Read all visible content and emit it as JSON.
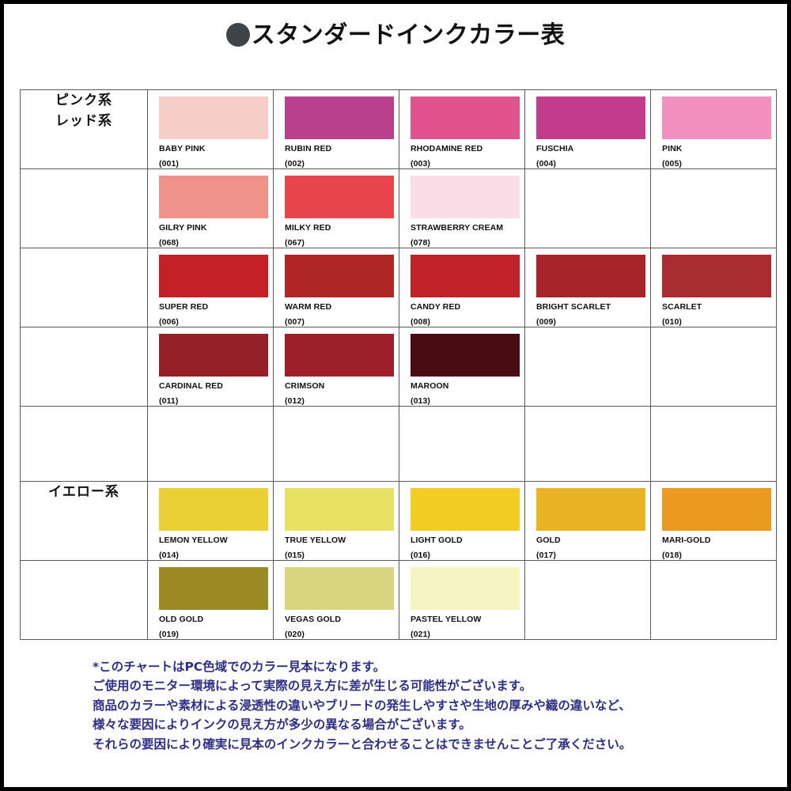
{
  "header": {
    "bullet_icon": "filled-circle-icon",
    "title": "スタンダードインクカラー表",
    "bullet_color": "#3f4449"
  },
  "table": {
    "rows": [
      {
        "category": [
          "ピンク系",
          "レッド系"
        ],
        "swatches": [
          {
            "name": "BABY PINK",
            "code": "(001)",
            "color": "#f7cdc8"
          },
          {
            "name": "RUBIN RED",
            "code": "(002)",
            "color": "#b8408c"
          },
          {
            "name": "RHODAMINE RED",
            "code": "(003)",
            "color": "#e0538f"
          },
          {
            "name": "FUSCHIA",
            "code": "(004)",
            "color": "#c33c8b"
          },
          {
            "name": "PINK",
            "code": "(005)",
            "color": "#f291bf"
          }
        ]
      },
      {
        "category": [],
        "swatches": [
          {
            "name": "GILRY PINK",
            "code": "(068)",
            "color": "#f0918a"
          },
          {
            "name": "MILKY RED",
            "code": "(067)",
            "color": "#e8464b"
          },
          {
            "name": "STRAWBERRY CREAM",
            "code": "(078)",
            "color": "#fbdde8"
          },
          {
            "name": "",
            "code": "",
            "color": ""
          },
          {
            "name": "",
            "code": "",
            "color": ""
          }
        ]
      },
      {
        "category": [],
        "swatches": [
          {
            "name": "SUPER RED",
            "code": "(006)",
            "color": "#c32127"
          },
          {
            "name": "WARM RED",
            "code": "(007)",
            "color": "#b02526"
          },
          {
            "name": "CANDY RED",
            "code": "(008)",
            "color": "#c0212a"
          },
          {
            "name": "BRIGHT SCARLET",
            "code": "(009)",
            "color": "#a72529"
          },
          {
            "name": "SCARLET",
            "code": "(010)",
            "color": "#a92c30"
          }
        ]
      },
      {
        "category": [],
        "swatches": [
          {
            "name": "CARDINAL RED",
            "code": "(011)",
            "color": "#952028"
          },
          {
            "name": "CRIMSON",
            "code": "(012)",
            "color": "#9c1f2b"
          },
          {
            "name": "MAROON",
            "code": "(013)",
            "color": "#480d12"
          },
          {
            "name": "",
            "code": "",
            "color": ""
          },
          {
            "name": "",
            "code": "",
            "color": ""
          }
        ]
      },
      {
        "category": [],
        "swatches": [
          {
            "name": "",
            "code": "",
            "color": ""
          },
          {
            "name": "",
            "code": "",
            "color": ""
          },
          {
            "name": "",
            "code": "",
            "color": ""
          },
          {
            "name": "",
            "code": "",
            "color": ""
          },
          {
            "name": "",
            "code": "",
            "color": ""
          }
        ]
      },
      {
        "category": [
          "イエロー系"
        ],
        "swatches": [
          {
            "name": "LEMON YELLOW",
            "code": "(014)",
            "color": "#ead035"
          },
          {
            "name": "TRUE YELLOW",
            "code": "(015)",
            "color": "#e8e063"
          },
          {
            "name": "LIGHT GOLD",
            "code": "(016)",
            "color": "#f3cd24"
          },
          {
            "name": "GOLD",
            "code": "(017)",
            "color": "#e8b423"
          },
          {
            "name": "MARI-GOLD",
            "code": "(018)",
            "color": "#ea9a1f"
          }
        ]
      },
      {
        "category": [],
        "swatches": [
          {
            "name": "OLD GOLD",
            "code": "(019)",
            "color": "#9c8a25"
          },
          {
            "name": "VEGAS GOLD",
            "code": "(020)",
            "color": "#d8d581"
          },
          {
            "name": "PASTEL YELLOW",
            "code": "(021)",
            "color": "#f7f4c4"
          },
          {
            "name": "",
            "code": "",
            "color": ""
          },
          {
            "name": "",
            "code": "",
            "color": ""
          }
        ]
      }
    ]
  },
  "note": {
    "color": "#2e2f84",
    "lines": [
      "*このチャートはPC色域でのカラー見本になります。",
      "ご使用のモニター環境によって実際の見え方に差が生じる可能性がございます。",
      "商品のカラーや素材による浸透性の違いやブリードの発生しやすさや生地の厚みや織の違いなど、",
      "様々な要因によりインクの見え方が多少の異なる場合がございます。",
      "それらの要因により確実に見本のインクカラーと合わせることはできませんことご了承ください。"
    ]
  }
}
